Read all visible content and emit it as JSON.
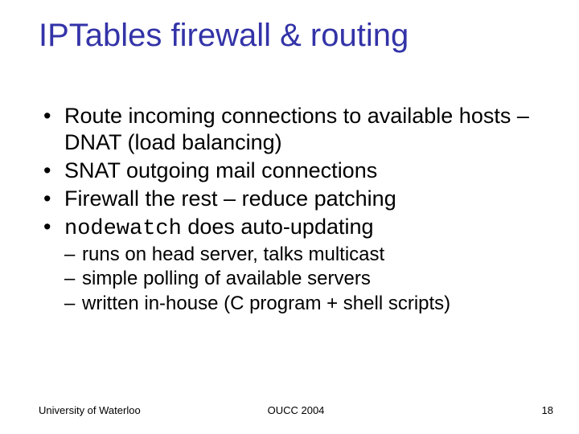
{
  "title": "IPTables firewall & routing",
  "bullets": {
    "b1": "Route incoming connections to available hosts – DNAT (load balancing)",
    "b2": "SNAT outgoing mail connections",
    "b3": "Firewall the rest – reduce patching",
    "b4_code": "nodewatch",
    "b4_rest": " does auto-updating"
  },
  "sub": {
    "s1": "runs on head server, talks multicast",
    "s2": "simple polling of available servers",
    "s3": "written in-house (C program + shell scripts)"
  },
  "footer": {
    "left": "University of Waterloo",
    "center": "OUCC 2004",
    "right": "18"
  }
}
